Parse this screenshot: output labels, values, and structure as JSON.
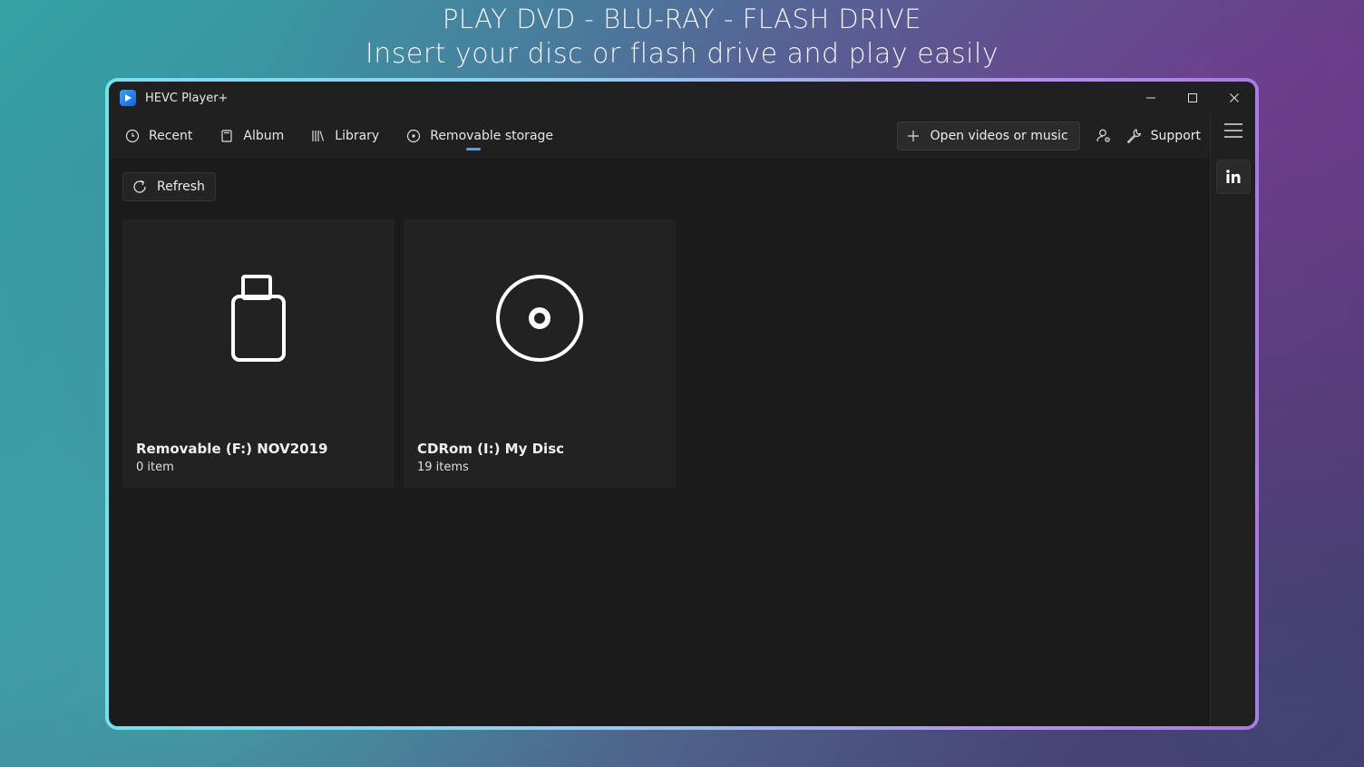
{
  "headline": {
    "line1": "PLAY DVD - BLU-RAY - FLASH DRIVE",
    "line2": "Insert your disc or flash drive and play easily"
  },
  "window": {
    "title": "HEVC Player+"
  },
  "nav": {
    "items": [
      {
        "label": "Recent",
        "icon": "clock-icon"
      },
      {
        "label": "Album",
        "icon": "album-icon"
      },
      {
        "label": "Library",
        "icon": "library-icon"
      },
      {
        "label": "Removable storage",
        "icon": "disc-icon",
        "active": true
      }
    ],
    "open_label": "Open videos or music",
    "support_label": "Support"
  },
  "content": {
    "refresh_label": "Refresh",
    "drives": [
      {
        "title": "Removable (F:) NOV2019",
        "subtitle": "0 item",
        "icon": "usb-drive-icon"
      },
      {
        "title": "CDRom (I:) My Disc",
        "subtitle": "19 items",
        "icon": "cd-disc-icon"
      }
    ]
  },
  "colors": {
    "accent": "#4aa3ff",
    "window_bg": "#1b1b1b",
    "chrome_bg": "#202020",
    "tile_bg": "#222222"
  }
}
